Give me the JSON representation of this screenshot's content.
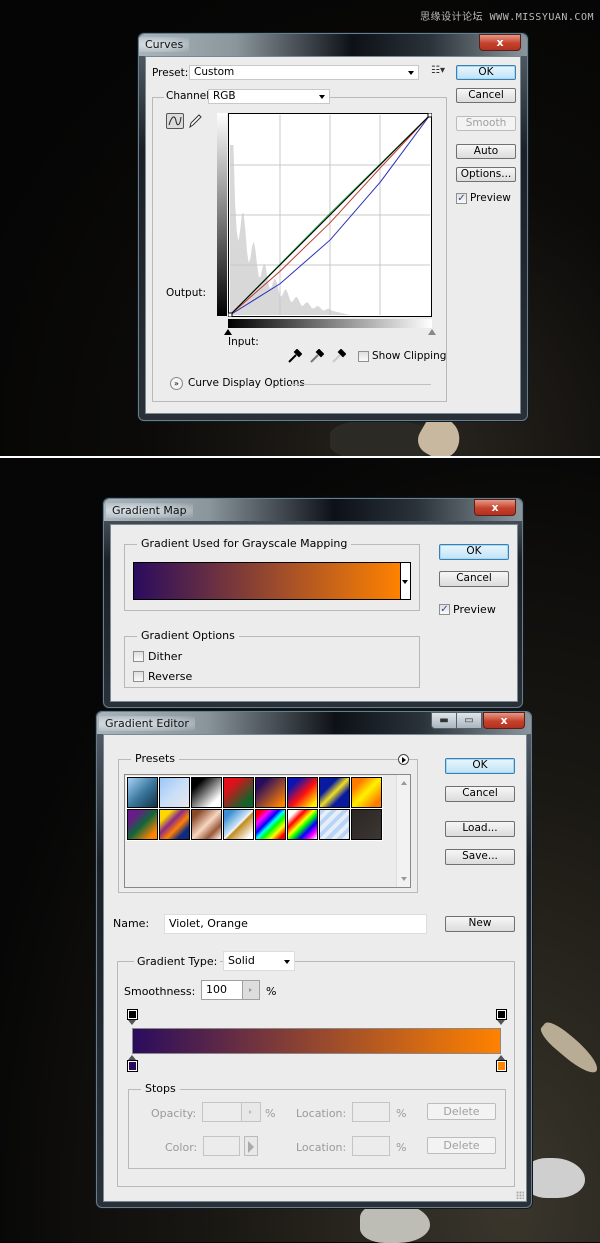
{
  "watermark": "思缘设计论坛 WWW.MISSYUAN.COM",
  "curves": {
    "title": "Curves",
    "close_glyph": "x",
    "preset_label": "Preset:",
    "preset_value": "Custom",
    "preset_menu_icon": "preset-options-icon",
    "channel_label": "Channel:",
    "channel_value": "RGB",
    "output_label": "Output:",
    "input_label": "Input:",
    "show_clipping_label": "Show Clipping",
    "show_clipping_checked": false,
    "curve_display_options_label": "Curve Display Options",
    "buttons": {
      "ok": "OK",
      "cancel": "Cancel",
      "smooth": "Smooth",
      "auto": "Auto",
      "options": "Options..."
    },
    "preview_label": "Preview",
    "preview_checked": true,
    "curve_colors": {
      "rgb": "#000000",
      "red": "#c0392b",
      "green": "#1e9e3a",
      "blue": "#2b2fb8"
    },
    "curves": {
      "rgb": [
        [
          0,
          0
        ],
        [
          255,
          255
        ]
      ],
      "green": [
        [
          0,
          0
        ],
        [
          128,
          130
        ],
        [
          255,
          255
        ]
      ],
      "red": [
        [
          0,
          0
        ],
        [
          64,
          56
        ],
        [
          128,
          118
        ],
        [
          192,
          188
        ],
        [
          255,
          255
        ]
      ],
      "blue": [
        [
          0,
          0
        ],
        [
          64,
          40
        ],
        [
          128,
          96
        ],
        [
          192,
          170
        ],
        [
          255,
          255
        ]
      ]
    }
  },
  "gradient_map": {
    "title": "Gradient Map",
    "close_glyph": "x",
    "group_label": "Gradient Used for Grayscale Mapping",
    "gradient_start": "#2a0c5e",
    "gradient_end": "#ff8200",
    "options_label": "Gradient Options",
    "dither_label": "Dither",
    "dither_checked": false,
    "reverse_label": "Reverse",
    "reverse_checked": false,
    "ok": "OK",
    "cancel": "Cancel",
    "preview_label": "Preview",
    "preview_checked": true
  },
  "gradient_editor": {
    "title": "Gradient Editor",
    "close_glyph": "x",
    "presets_label": "Presets",
    "presets": [
      {
        "name": "foreground-to-background",
        "css": "linear-gradient(135deg,#a9d1f5,#3d7aa0 50%,#123244)"
      },
      {
        "name": "foreground-to-transparent",
        "css": "linear-gradient(135deg,#9cc6f5,#c9def9 50%,#e6e6e6)"
      },
      {
        "name": "black-white",
        "css": "linear-gradient(135deg,#000 20%,#fff 80%)"
      },
      {
        "name": "red-green",
        "css": "linear-gradient(135deg,#e0101a 25%,#11632a 80%)"
      },
      {
        "name": "violet-orange",
        "css": "linear-gradient(135deg,#2a0c5e 20%,#ff8200 90%)"
      },
      {
        "name": "blue-red-yellow",
        "css": "linear-gradient(135deg,#0b14b0 20%,#ff1010 55%,#fff200 90%)"
      },
      {
        "name": "blue-yellow-blue",
        "css": "linear-gradient(135deg,#0a1aa0 30%,#f0e020 50%,#0a1aa0 70%)"
      },
      {
        "name": "orange-yellow-orange",
        "css": "linear-gradient(135deg,#ff7a00 20%,#fff200 50%,#ff7a00 85%)"
      },
      {
        "name": "violet-green-orange",
        "css": "linear-gradient(135deg,#6a1a8a 20%,#12663a 50%,#ff8200 85%)"
      },
      {
        "name": "yellow-violet-orange-blue",
        "css": "linear-gradient(135deg,#ffd800 20%,#8a2a8a 40%,#ff8000 60%,#102a80 80%)"
      },
      {
        "name": "copper",
        "css": "linear-gradient(135deg,#8a4a2a 15%,#f7d6c0 50%,#9a5a3a 75%,#f2dcd0 95%)"
      },
      {
        "name": "chrome",
        "css": "linear-gradient(135deg,#3b8fd2 15%,#cfe6f8 48%,#fff 50%,#c08a20 55%,#fff 90%)"
      },
      {
        "name": "spectrum",
        "css": "linear-gradient(135deg,#f00 10%,#f0f 25%,#00f 40%,#0ff 50%,#0f0 60%,#ff0 75%,#f00 90%)"
      },
      {
        "name": "transparent-rainbow",
        "css": "linear-gradient(135deg,#fff 15%,#f00 30%,#ff0 45%,#0f0 55%,#00f 70%,#f0f 85%,#fff)"
      },
      {
        "name": "transparent-stripes",
        "css": "repeating-linear-gradient(135deg,#b8d4f6 0 4px,#e8eef7 4px 8px)"
      },
      {
        "name": "dark-gray",
        "css": "linear-gradient(135deg,#2a2624,#3d3733)"
      }
    ],
    "presets_menu_icon": "presets-menu-arrow-icon",
    "buttons": {
      "ok": "OK",
      "cancel": "Cancel",
      "load": "Load...",
      "save": "Save...",
      "new": "New"
    },
    "name_label": "Name:",
    "name_value": "Violet, Orange",
    "gradient_type_label": "Gradient Type:",
    "gradient_type_value": "Solid",
    "smoothness_label": "Smoothness:",
    "smoothness_value": "100",
    "smoothness_unit": "%",
    "gradient_start": "#2a0c5e",
    "gradient_end": "#ff8200",
    "opacity_stops": [
      {
        "location": 0,
        "color": "#000000"
      },
      {
        "location": 100,
        "color": "#000000"
      }
    ],
    "color_stops": [
      {
        "location": 0,
        "color": "#2a0c5e"
      },
      {
        "location": 100,
        "color": "#ff8200"
      }
    ],
    "stops_label": "Stops",
    "opacity_label": "Opacity:",
    "opacity_unit": "%",
    "color_label": "Color:",
    "location_label": "Location:",
    "location_unit": "%",
    "delete_label": "Delete"
  }
}
